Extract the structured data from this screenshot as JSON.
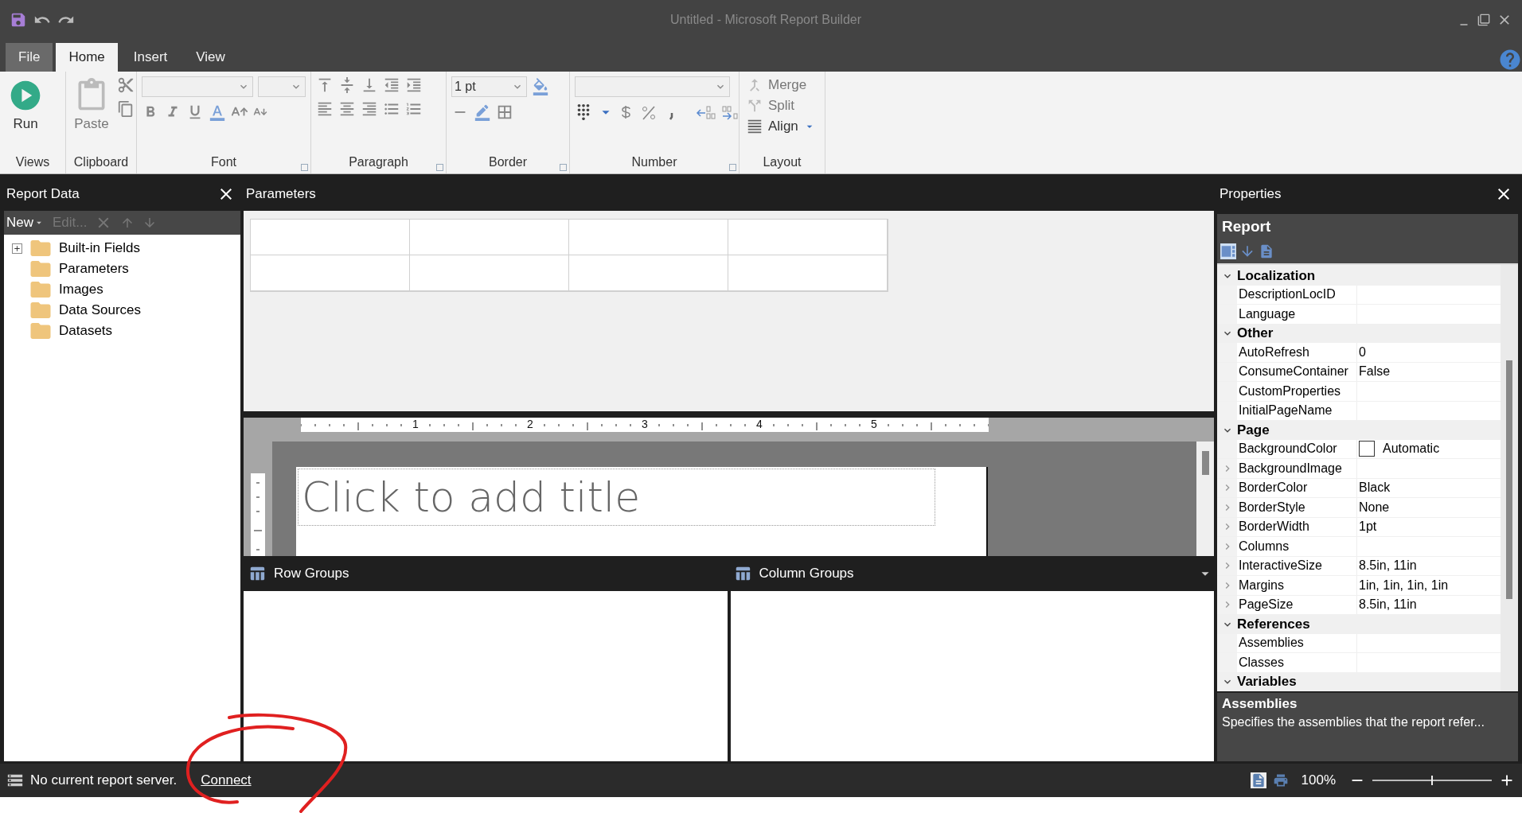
{
  "window": {
    "title": "Untitled - Microsoft Report Builder"
  },
  "tabs": [
    {
      "label": "File",
      "kind": "file",
      "selected": false
    },
    {
      "label": "Home",
      "kind": "tab",
      "selected": true
    },
    {
      "label": "Insert",
      "kind": "tab",
      "selected": false
    },
    {
      "label": "View",
      "kind": "tab",
      "selected": false
    }
  ],
  "ribbon": {
    "groups": [
      {
        "kind": "views",
        "label": "Views",
        "buttons": [
          {
            "label": "Run",
            "disabled": false
          }
        ]
      },
      {
        "kind": "clipboard",
        "label": "Clipboard",
        "buttons": [
          {
            "label": "Paste",
            "disabled": true
          }
        ]
      },
      {
        "kind": "font",
        "label": "Font"
      },
      {
        "kind": "paragraph",
        "label": "Paragraph"
      },
      {
        "kind": "border",
        "label": "Border",
        "width_value": "1 pt"
      },
      {
        "kind": "number",
        "label": "Number"
      },
      {
        "kind": "layout",
        "label": "Layout",
        "buttons": [
          {
            "label": "Merge",
            "disabled": true
          },
          {
            "label": "Split",
            "disabled": true
          },
          {
            "label": "Align",
            "disabled": false
          }
        ]
      }
    ]
  },
  "report_data": {
    "title": "Report Data",
    "toolbar": [
      {
        "label": "New",
        "disabled": false
      },
      {
        "label": "Edit...",
        "disabled": true
      }
    ],
    "tree": [
      {
        "label": "Built-in Fields",
        "kind": "expandable",
        "expanded": false
      },
      {
        "label": "Parameters",
        "kind": "leaf"
      },
      {
        "label": "Images",
        "kind": "leaf"
      },
      {
        "label": "Data Sources",
        "kind": "leaf"
      },
      {
        "label": "Datasets",
        "kind": "leaf"
      }
    ]
  },
  "parameters": {
    "title": "Parameters"
  },
  "design": {
    "ruler": [
      "1",
      "2",
      "3",
      "4",
      "5"
    ],
    "title_placeholder": "Click to add title"
  },
  "groups": {
    "row_title": "Row Groups",
    "column_title": "Column Groups"
  },
  "properties": {
    "title": "Properties",
    "object": "Report",
    "categories": [
      {
        "name": "Localization",
        "expanded": true,
        "rows": [
          {
            "name": "DescriptionLocID",
            "kind": "plain"
          },
          {
            "name": "Language",
            "kind": "plain"
          }
        ]
      },
      {
        "name": "Other",
        "expanded": true,
        "rows": [
          {
            "name": "AutoRefresh",
            "value": "0",
            "kind": "plain"
          },
          {
            "name": "ConsumeContainer",
            "value": "False",
            "kind": "plain"
          },
          {
            "name": "CustomProperties",
            "kind": "plain"
          },
          {
            "name": "InitialPageName",
            "kind": "plain"
          }
        ]
      },
      {
        "name": "Page",
        "expanded": true,
        "rows": [
          {
            "name": "BackgroundColor",
            "value": "Automatic",
            "kind": "color"
          },
          {
            "name": "BackgroundImage",
            "kind": "expandable"
          },
          {
            "name": "BorderColor",
            "value": "Black",
            "kind": "expandable"
          },
          {
            "name": "BorderStyle",
            "value": "None",
            "kind": "expandable"
          },
          {
            "name": "BorderWidth",
            "value": "1pt",
            "kind": "expandable"
          },
          {
            "name": "Columns",
            "kind": "expandable"
          },
          {
            "name": "InteractiveSize",
            "value": "8.5in, 11in",
            "kind": "expandable"
          },
          {
            "name": "Margins",
            "value": "1in, 1in, 1in, 1in",
            "kind": "expandable"
          },
          {
            "name": "PageSize",
            "value": "8.5in, 11in",
            "kind": "expandable"
          }
        ]
      },
      {
        "name": "References",
        "expanded": true,
        "rows": [
          {
            "name": "Assemblies",
            "kind": "plain"
          },
          {
            "name": "Classes",
            "kind": "plain"
          }
        ]
      },
      {
        "name": "Variables",
        "expanded": true
      }
    ],
    "description": {
      "title": "Assemblies",
      "text": "Specifies the assemblies that the report refer..."
    }
  },
  "status_bar": {
    "message": "No current report server.",
    "link": "Connect",
    "zoom": "100%",
    "zoom_slider": {
      "level": 0.5
    }
  }
}
